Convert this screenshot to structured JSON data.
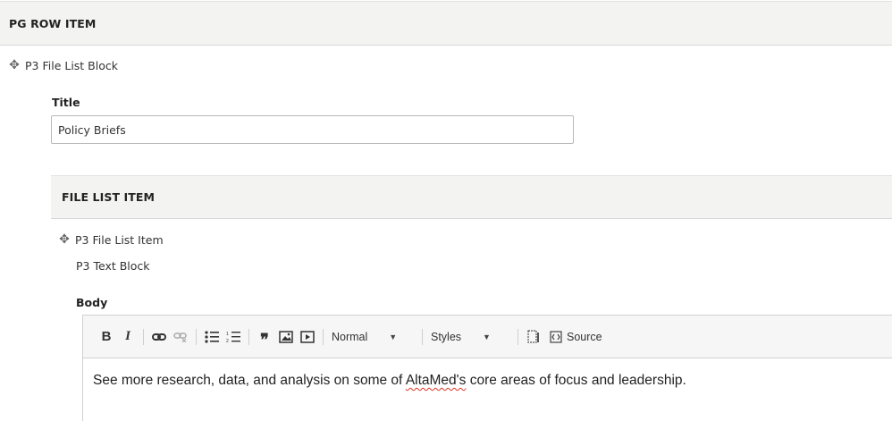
{
  "pg_row_item": {
    "header": "PG ROW ITEM",
    "block_label": "P3 File List Block",
    "title_field": {
      "label": "Title",
      "value": "Policy Briefs"
    }
  },
  "file_list_item": {
    "header": "FILE LIST ITEM",
    "item_label": "P3 File List Item",
    "text_block_label": "P3 Text Block",
    "body_label": "Body"
  },
  "toolbar": {
    "bold_label": "B",
    "italic_label": "I",
    "format_value": "Normal",
    "styles_value": "Styles",
    "source_label": "Source",
    "icons": [
      "link-icon",
      "unlink-icon",
      "bulleted-list-icon",
      "numbered-list-icon",
      "blockquote-icon",
      "image-icon",
      "media-icon",
      "show-blocks-icon",
      "source-icon"
    ]
  },
  "editor": {
    "text_before": "See more research, data, and analysis on some of ",
    "text_misspelled": "AltaMed's",
    "text_after": " core areas of focus and leadership."
  },
  "colors": {
    "header_bg": "#f3f3f2",
    "toolbar_bg": "#f6f6f6",
    "border": "#d1d1d1",
    "spellcheck": "#dd3322"
  }
}
